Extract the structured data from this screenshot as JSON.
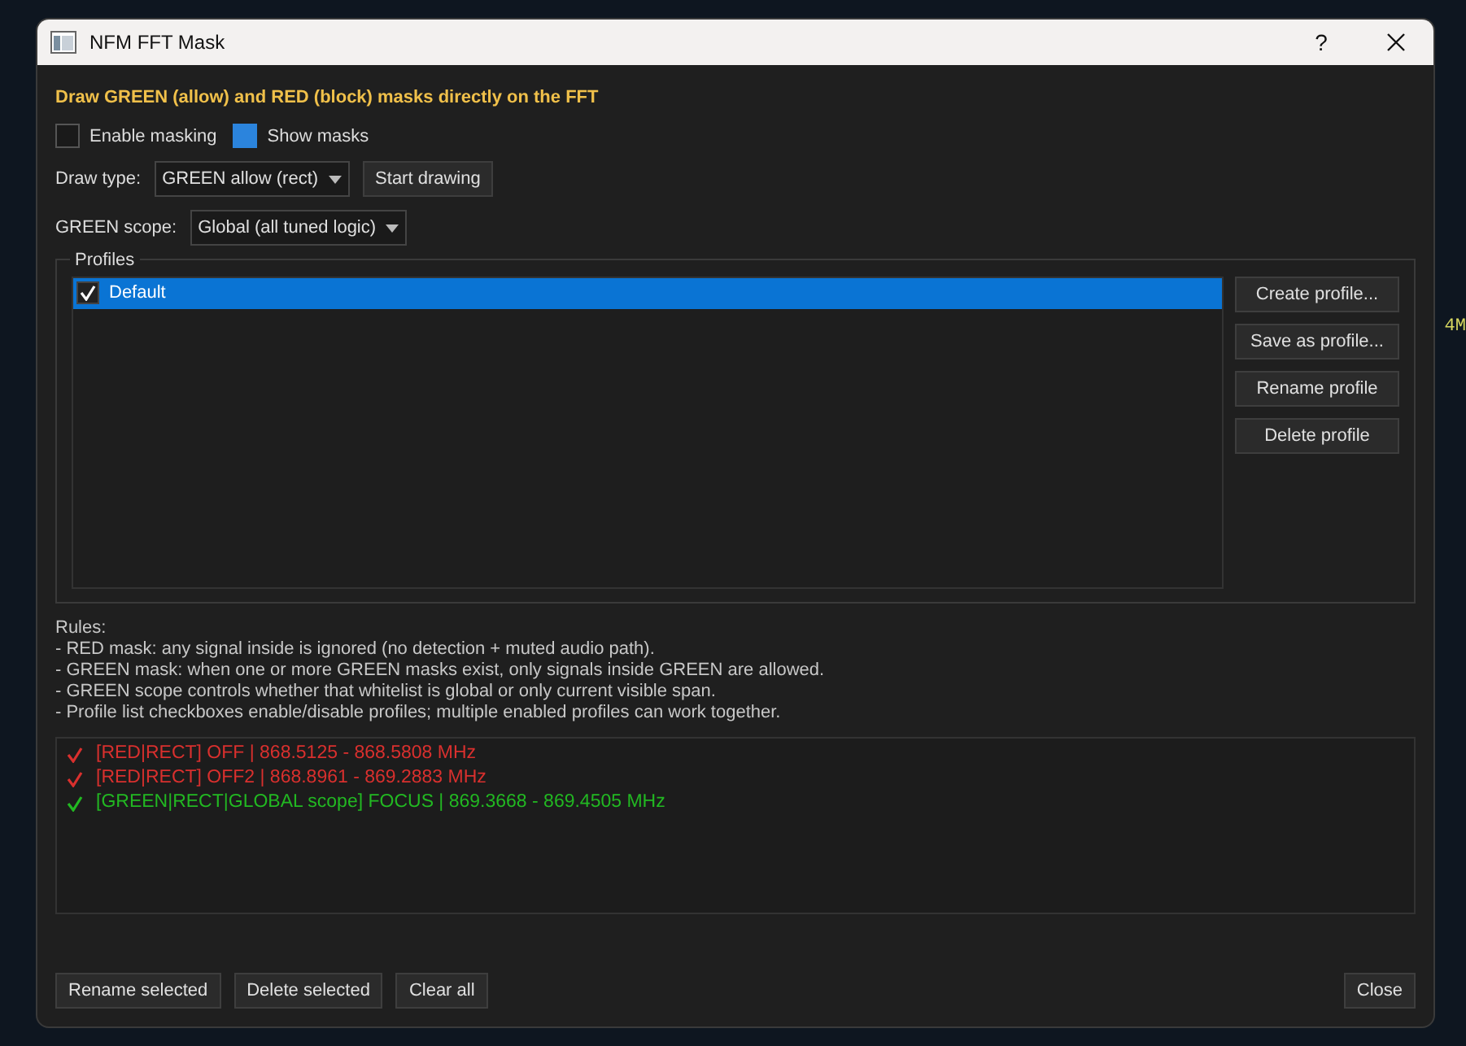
{
  "background": {
    "axis_label": "4M"
  },
  "window": {
    "title": "NFM FFT Mask",
    "help": "?"
  },
  "heading": "Draw GREEN (allow) and RED (block) masks directly on the FFT",
  "options": [
    {
      "label": "Enable masking",
      "checked": false
    },
    {
      "label": "Show masks",
      "checked": true
    }
  ],
  "draw_type": {
    "label": "Draw type:",
    "value": "GREEN allow (rect)",
    "button": "Start drawing"
  },
  "green_scope": {
    "label": "GREEN scope:",
    "value": "Global (all tuned logic)"
  },
  "profiles": {
    "title": "Profiles",
    "items": [
      {
        "name": "Default",
        "checked": true,
        "selected": true
      }
    ],
    "buttons": [
      "Create profile...",
      "Save as profile...",
      "Rename profile",
      "Delete profile"
    ]
  },
  "rules": [
    "Rules:",
    "- RED mask: any signal inside is ignored (no detection + muted audio path).",
    "- GREEN mask: when one or more GREEN masks exist, only signals inside GREEN are allowed.",
    "- GREEN scope controls whether that whitelist is global or only current visible span.",
    "- Profile list checkboxes enable/disable profiles; multiple enabled profiles can work together."
  ],
  "masks": [
    {
      "text": "[RED|RECT] OFF | 868.5125 - 868.5808 MHz",
      "checked": true,
      "color": "#d9302e"
    },
    {
      "text": "[RED|RECT] OFF2 | 868.8961 - 869.2883 MHz",
      "checked": true,
      "color": "#d9302e"
    },
    {
      "text": "[GREEN|RECT|GLOBAL scope] FOCUS | 869.3668 - 869.4505 MHz",
      "checked": true,
      "color": "#22b822"
    }
  ],
  "footer_buttons": [
    "Rename selected",
    "Delete selected",
    "Clear all"
  ],
  "close_button": "Close"
}
